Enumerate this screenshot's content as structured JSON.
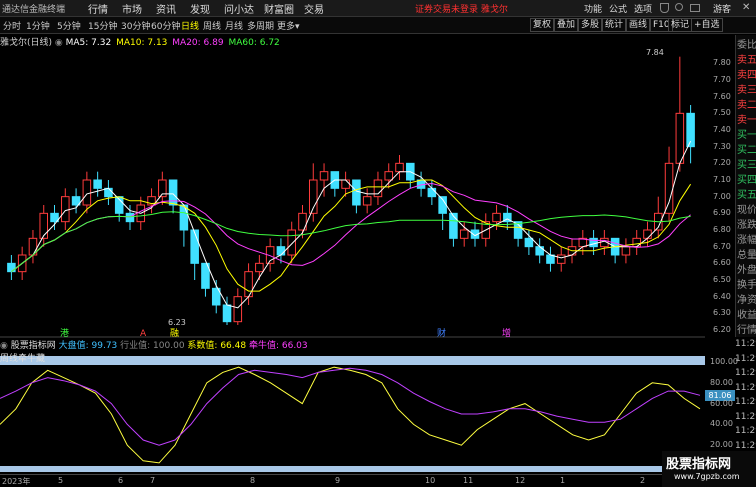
{
  "menubar": {
    "app_title": "通达信金融终端",
    "items": [
      "行情",
      "市场",
      "资讯",
      "发现",
      "问小达",
      "财富圈",
      "交易"
    ],
    "notice": "证券交易未登录",
    "notice_stock": "雅戈尔",
    "right_menu": [
      "功能",
      "公式",
      "选项"
    ],
    "guest": "游客"
  },
  "period_bar": {
    "periods": [
      "分时",
      "1分钟",
      "5分钟",
      "15分钟",
      "30分钟",
      "60分钟",
      "日线",
      "周线",
      "月线",
      "多周期",
      "更多"
    ],
    "active": "日线",
    "tools": [
      "复权",
      "叠加",
      "多股",
      "统计",
      "画线",
      "F10",
      "标记",
      "+自选"
    ]
  },
  "main_header": {
    "title": "雅戈尔(日线)",
    "ma": [
      {
        "label": "MA5: 7.32",
        "color": "#ffffff"
      },
      {
        "label": "MA10: 7.13",
        "color": "#ffff00"
      },
      {
        "label": "MA20: 6.89",
        "color": "#ff40ff"
      },
      {
        "label": "MA60: 6.72",
        "color": "#40ff40"
      }
    ]
  },
  "price_axis": [
    "7.80",
    "7.70",
    "7.60",
    "7.50",
    "7.40",
    "7.30",
    "7.20",
    "7.10",
    "7.00",
    "6.90",
    "6.80",
    "6.70",
    "6.60",
    "6.50",
    "6.40",
    "6.30",
    "6.20"
  ],
  "annotations": {
    "high": "7.84",
    "low": "6.23",
    "marks": [
      {
        "text": "港",
        "color": "#40ff40"
      },
      {
        "text": "A",
        "color": "#ff4040"
      },
      {
        "text": "融",
        "color": "#ffff00"
      },
      {
        "text": "财",
        "color": "#4080ff"
      },
      {
        "text": "增",
        "color": "#ff40ff"
      }
    ]
  },
  "sub_header": {
    "title": "股票指标网",
    "items": [
      {
        "label": "大盘值: 99.73",
        "color": "#40c0ff"
      },
      {
        "label": "行业值: 100.00",
        "color": "#888888"
      },
      {
        "label": "系数值: 66.48",
        "color": "#ffff00"
      },
      {
        "label": "牵牛值: 66.03",
        "color": "#ff40ff"
      }
    ],
    "indicator_name": "周线牵牛藏"
  },
  "sub_axis": [
    "100.00",
    "80.00",
    "60.00",
    "40.00",
    "20.00"
  ],
  "sub_axis_label": "81.06",
  "date_axis": [
    "2023年",
    "5",
    "6",
    "7",
    "8",
    "9",
    "10",
    "11",
    "12",
    "1",
    "2"
  ],
  "side_panel": {
    "rows": [
      {
        "t": "委比",
        "c": "dim"
      },
      {
        "t": "卖五",
        "c": "up"
      },
      {
        "t": "卖四",
        "c": "up"
      },
      {
        "t": "卖三",
        "c": "up"
      },
      {
        "t": "卖二",
        "c": "up"
      },
      {
        "t": "卖一",
        "c": "up"
      },
      {
        "t": "买一",
        "c": "dn"
      },
      {
        "t": "买二",
        "c": "dn"
      },
      {
        "t": "买三",
        "c": "dn"
      },
      {
        "t": "买四",
        "c": "dn"
      },
      {
        "t": "买五",
        "c": "dn"
      },
      {
        "t": "现价",
        "c": "dim"
      },
      {
        "t": "涨跌",
        "c": "dim"
      },
      {
        "t": "涨幅",
        "c": "dim"
      },
      {
        "t": "总量",
        "c": "dim"
      },
      {
        "t": "外盘",
        "c": "dim"
      },
      {
        "t": "换手",
        "c": "dim"
      },
      {
        "t": "净资",
        "c": "dim"
      },
      {
        "t": "收益",
        "c": "dim"
      },
      {
        "t": "行情",
        "c": "dim"
      }
    ],
    "times": [
      "11:29",
      "11:29",
      "11:29",
      "11:29",
      "11:29",
      "11:29",
      "11:29",
      "11:29",
      "11:29",
      "11:29"
    ]
  },
  "watermark": {
    "title": "股票指标网",
    "url": "www.7gpzb.com"
  },
  "chart_data": {
    "type": "candlestick",
    "instrument": "雅戈尔",
    "period": "日线",
    "ylim": [
      6.2,
      7.85
    ],
    "x_start": "2023",
    "candles": [
      [
        6.6,
        6.55,
        6.65,
        6.5
      ],
      [
        6.55,
        6.65,
        6.7,
        6.5
      ],
      [
        6.65,
        6.75,
        6.8,
        6.6
      ],
      [
        6.75,
        6.9,
        6.95,
        6.7
      ],
      [
        6.9,
        6.85,
        6.95,
        6.8
      ],
      [
        6.85,
        7.0,
        7.05,
        6.8
      ],
      [
        7.0,
        6.95,
        7.05,
        6.9
      ],
      [
        6.95,
        7.1,
        7.15,
        6.9
      ],
      [
        7.1,
        7.05,
        7.15,
        7.0
      ],
      [
        7.05,
        7.0,
        7.1,
        6.95
      ],
      [
        7.0,
        6.9,
        7.0,
        6.85
      ],
      [
        6.9,
        6.85,
        6.95,
        6.8
      ],
      [
        6.85,
        6.95,
        7.0,
        6.8
      ],
      [
        6.95,
        7.0,
        7.05,
        6.9
      ],
      [
        7.0,
        7.1,
        7.15,
        6.95
      ],
      [
        7.1,
        6.95,
        7.1,
        6.9
      ],
      [
        6.95,
        6.8,
        6.95,
        6.7
      ],
      [
        6.8,
        6.6,
        6.8,
        6.5
      ],
      [
        6.6,
        6.45,
        6.6,
        6.4
      ],
      [
        6.45,
        6.35,
        6.5,
        6.3
      ],
      [
        6.35,
        6.25,
        6.4,
        6.23
      ],
      [
        6.25,
        6.4,
        6.45,
        6.23
      ],
      [
        6.4,
        6.55,
        6.6,
        6.35
      ],
      [
        6.55,
        6.6,
        6.65,
        6.5
      ],
      [
        6.6,
        6.7,
        6.75,
        6.55
      ],
      [
        6.7,
        6.65,
        6.75,
        6.6
      ],
      [
        6.65,
        6.8,
        6.85,
        6.6
      ],
      [
        6.8,
        6.9,
        6.95,
        6.75
      ],
      [
        6.9,
        7.1,
        7.2,
        6.85
      ],
      [
        7.1,
        7.15,
        7.2,
        7.0
      ],
      [
        7.15,
        7.05,
        7.15,
        7.0
      ],
      [
        7.05,
        7.1,
        7.15,
        7.0
      ],
      [
        7.1,
        6.95,
        7.1,
        6.9
      ],
      [
        6.95,
        7.0,
        7.05,
        6.9
      ],
      [
        7.0,
        7.1,
        7.15,
        6.95
      ],
      [
        7.1,
        7.15,
        7.2,
        7.05
      ],
      [
        7.15,
        7.2,
        7.25,
        7.1
      ],
      [
        7.2,
        7.1,
        7.2,
        7.05
      ],
      [
        7.1,
        7.05,
        7.15,
        7.0
      ],
      [
        7.05,
        7.0,
        7.1,
        6.95
      ],
      [
        7.0,
        6.9,
        7.0,
        6.8
      ],
      [
        6.9,
        6.75,
        6.9,
        6.7
      ],
      [
        6.75,
        6.8,
        6.85,
        6.7
      ],
      [
        6.8,
        6.75,
        6.85,
        6.7
      ],
      [
        6.75,
        6.85,
        6.9,
        6.7
      ],
      [
        6.85,
        6.9,
        6.95,
        6.8
      ],
      [
        6.9,
        6.85,
        6.95,
        6.8
      ],
      [
        6.85,
        6.75,
        6.85,
        6.7
      ],
      [
        6.75,
        6.7,
        6.8,
        6.65
      ],
      [
        6.7,
        6.65,
        6.75,
        6.6
      ],
      [
        6.65,
        6.6,
        6.7,
        6.55
      ],
      [
        6.6,
        6.65,
        6.7,
        6.55
      ],
      [
        6.65,
        6.7,
        6.75,
        6.6
      ],
      [
        6.7,
        6.75,
        6.8,
        6.65
      ],
      [
        6.75,
        6.7,
        6.8,
        6.65
      ],
      [
        6.7,
        6.75,
        6.8,
        6.65
      ],
      [
        6.75,
        6.65,
        6.75,
        6.6
      ],
      [
        6.65,
        6.7,
        6.75,
        6.6
      ],
      [
        6.7,
        6.75,
        6.8,
        6.65
      ],
      [
        6.75,
        6.8,
        6.85,
        6.7
      ],
      [
        6.8,
        6.9,
        7.0,
        6.75
      ],
      [
        6.9,
        7.2,
        7.3,
        6.85
      ],
      [
        7.2,
        7.5,
        7.84,
        7.15
      ],
      [
        7.5,
        7.3,
        7.55,
        7.2
      ]
    ],
    "ma_series": [
      {
        "name": "MA5",
        "last": 7.32,
        "color": "#ffffff"
      },
      {
        "name": "MA10",
        "last": 7.13,
        "color": "#ffff00"
      },
      {
        "name": "MA20",
        "last": 6.89,
        "color": "#ff40ff"
      },
      {
        "name": "MA60",
        "last": 6.72,
        "color": "#40ff40"
      }
    ],
    "indicator": {
      "ylim": [
        0,
        100
      ],
      "yellow": [
        40,
        55,
        80,
        92,
        85,
        78,
        70,
        50,
        20,
        5,
        3,
        20,
        50,
        80,
        90,
        95,
        88,
        80,
        70,
        60,
        90,
        95,
        92,
        88,
        80,
        55,
        40,
        30,
        25,
        20,
        35,
        45,
        55,
        60,
        50,
        40,
        30,
        25,
        30,
        50,
        70,
        80,
        78,
        65,
        55
      ],
      "purple": [
        65,
        72,
        80,
        85,
        82,
        78,
        72,
        60,
        40,
        25,
        20,
        25,
        40,
        60,
        75,
        88,
        92,
        90,
        88,
        85,
        90,
        92,
        94,
        92,
        88,
        80,
        70,
        62,
        55,
        50,
        50,
        52,
        55,
        55,
        52,
        48,
        45,
        42,
        42,
        45,
        55,
        65,
        72,
        72,
        68
      ]
    }
  }
}
